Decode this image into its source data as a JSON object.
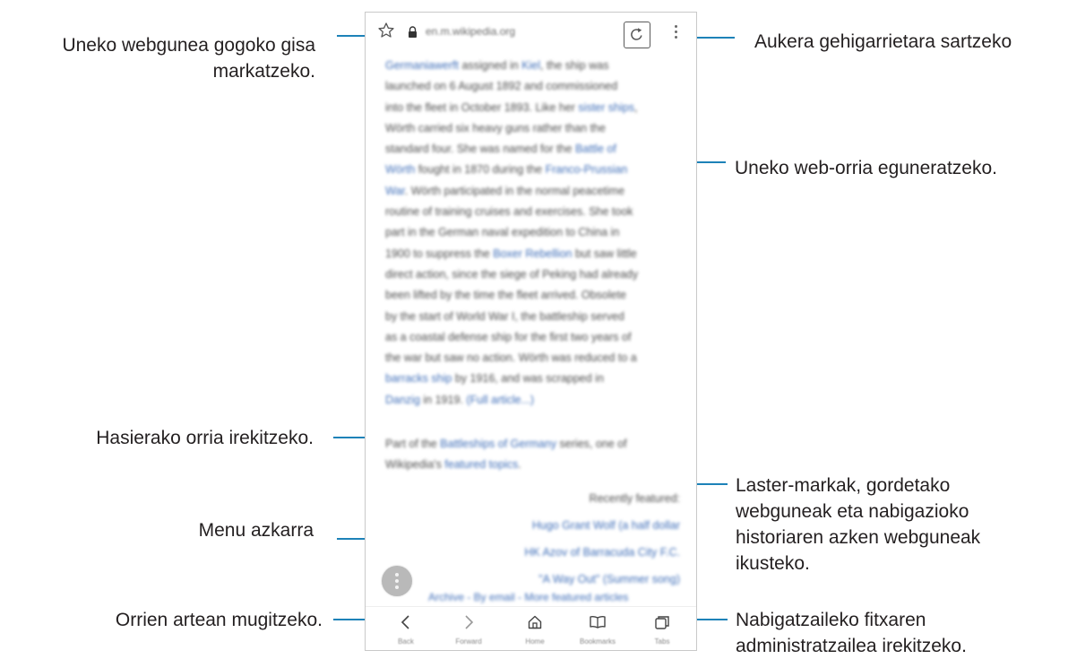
{
  "callouts": {
    "bookmark": [
      "Uneko webgunea gogoko gisa",
      "markatzeko."
    ],
    "more_options": "Aukera gehigarrietara sartzeko",
    "refresh": "Uneko web-orria eguneratzeko.",
    "home": "Hasierako orria irekitzeko.",
    "quick_menu": "Menu azkarra",
    "navigate": "Orrien artean mugitzeko.",
    "bookmarks": [
      "Laster-markak, gordetako",
      "webguneak eta nabigazioko",
      "historiaren azken webguneak",
      "ikusteko."
    ],
    "tabs": [
      "Nabigatzaileko fitxaren",
      "administratzailea irekitzeko."
    ]
  },
  "browser": {
    "url": "en.m.wikipedia.org",
    "article_lines": [
      [
        "",
        "Germaniawerft",
        " assigned in ",
        "Kiel",
        ", the ship was"
      ],
      [
        "launched on 6 August 1892 and commissioned",
        "",
        "",
        "",
        ""
      ],
      [
        "into the fleet in October 1893. Like her ",
        "sister ships",
        ",",
        "",
        ""
      ],
      [
        "Wörth carried six heavy guns rather than the",
        "",
        "",
        "",
        ""
      ],
      [
        "standard four. She was named for the ",
        "Battle of",
        "",
        "",
        ""
      ],
      [
        "",
        "Wörth",
        " fought in 1870 during the ",
        "Franco-Prussian",
        ""
      ],
      [
        "",
        "War",
        ". Wörth participated in the normal peacetime",
        "",
        ""
      ],
      [
        "routine of training cruises and exercises. She took",
        "",
        "",
        "",
        ""
      ],
      [
        "part in the German naval expedition to China in",
        "",
        "",
        "",
        ""
      ],
      [
        "1900 to suppress the ",
        "Boxer Rebellion",
        " but saw little",
        "",
        ""
      ],
      [
        "direct action, since the siege of Peking had already",
        "",
        "",
        "",
        ""
      ],
      [
        "been lifted by the time the fleet arrived. Obsolete",
        "",
        "",
        "",
        ""
      ],
      [
        "by the start of World War I, the battleship served",
        "",
        "",
        "",
        ""
      ],
      [
        "as a coastal defense ship for the first two years of",
        "",
        "",
        "",
        ""
      ],
      [
        "the war but saw no action. Wörth was reduced to a",
        "",
        "",
        "",
        ""
      ],
      [
        "",
        "barracks ship",
        " by 1916, and was scrapped in",
        "",
        ""
      ],
      [
        "",
        "Danzig",
        " in 1919. ",
        "(Full article...)",
        ""
      ]
    ],
    "related_lines": [
      [
        "Part of the ",
        "Battleships of Germany",
        " series, one of"
      ],
      [
        "Wikipedia's ",
        "featured topics",
        "."
      ]
    ],
    "featured": [
      "Recently featured:",
      "Hugo Grant Wolf (a half dollar",
      "HK Azov of Barracuda City F.C.",
      "\"A Way Out\" (Summer song)"
    ],
    "bottom_links": "Archive - By email - More featured articles",
    "nav_labels": {
      "back": "Back",
      "forward": "Forward",
      "home": "Home",
      "bookmarks": "Bookmarks",
      "tabs": "Tabs"
    }
  },
  "icons": {
    "bookmark_star": "star-outline-icon",
    "secure": "lock-icon",
    "reload": "reload-icon",
    "more": "kebab-menu-icon",
    "quick_menu": "quick-menu-icon",
    "back": "chevron-left-icon",
    "forward": "chevron-right-icon",
    "home": "home-icon",
    "bookmarks": "open-book-icon",
    "tabs": "tabs-icon"
  },
  "colors": {
    "callout_line": "#1d82b8",
    "text": "#231f20",
    "link": "#3f6eb8"
  }
}
